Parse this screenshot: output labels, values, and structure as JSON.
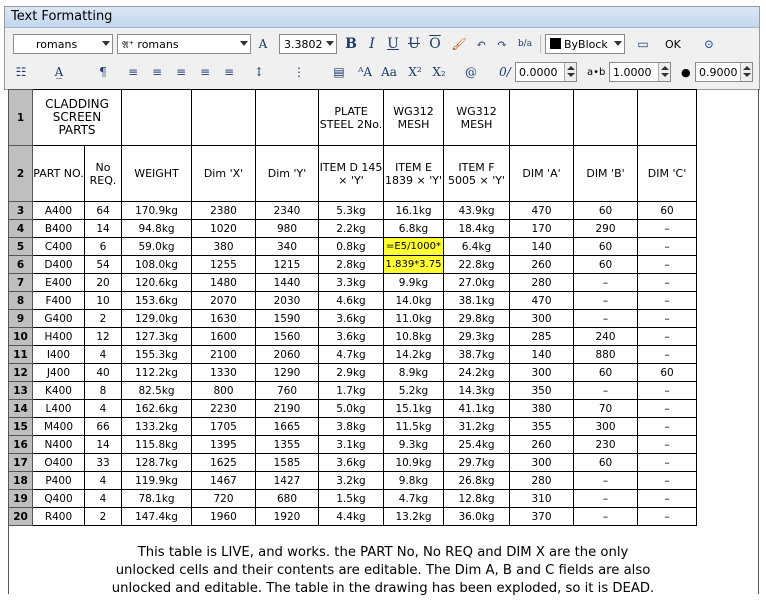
{
  "window": {
    "title": "Text Formatting"
  },
  "toolbar_row1": {
    "style_value": "romans",
    "font_value": "romans",
    "height_value": "3.3802",
    "bold": "B",
    "italic": "I",
    "underline": "U",
    "overline": "O",
    "stack": "b/a",
    "color_value": "ByBlock",
    "ok": "OK"
  },
  "toolbar_row2": {
    "oblique_value": "0.0000",
    "tracking_value": "1.0000",
    "width_value": "0.9000",
    "superscript": "X²",
    "subscript": "X₂",
    "at": "@"
  },
  "table": {
    "row1": {
      "num": "1",
      "title": "CLADDING SCREEN PARTS",
      "plate": "PLATE STEEL 2No.",
      "mesh1": "WG312 MESH",
      "mesh2": "WG312 MESH"
    },
    "row2": {
      "num": "2",
      "headers": [
        "PART NO.",
        "No REQ.",
        "WEIGHT",
        "Dim 'X'",
        "Dim 'Y'",
        "ITEM D 145 × 'Y'",
        "ITEM E 1839 × 'Y'",
        "ITEM F 5005 × 'Y'",
        "DIM 'A'",
        "DIM 'B'",
        "DIM 'C'"
      ]
    },
    "rows": [
      {
        "n": "3",
        "c": [
          "A400",
          "64",
          "170.9kg",
          "2380",
          "2340",
          "5.3kg",
          "16.1kg",
          "43.9kg",
          "470",
          "60",
          "60"
        ]
      },
      {
        "n": "4",
        "c": [
          "B400",
          "14",
          "94.8kg",
          "1020",
          "980",
          "2.2kg",
          "6.8kg",
          "18.4kg",
          "170",
          "290",
          "–"
        ]
      },
      {
        "n": "5",
        "c": [
          "C400",
          "6",
          "59.0kg",
          "380",
          "340",
          "0.8kg",
          "=E5/1000*",
          "6.4kg",
          "140",
          "60",
          "–"
        ]
      },
      {
        "n": "6",
        "c": [
          "D400",
          "54",
          "108.0kg",
          "1255",
          "1215",
          "2.8kg",
          "1.839*3.75",
          "22.8kg",
          "260",
          "60",
          "–"
        ]
      },
      {
        "n": "7",
        "c": [
          "E400",
          "20",
          "120.6kg",
          "1480",
          "1440",
          "3.3kg",
          "9.9kg",
          "27.0kg",
          "280",
          "–",
          "–"
        ]
      },
      {
        "n": "8",
        "c": [
          "F400",
          "10",
          "153.6kg",
          "2070",
          "2030",
          "4.6kg",
          "14.0kg",
          "38.1kg",
          "470",
          "–",
          "–"
        ]
      },
      {
        "n": "9",
        "c": [
          "G400",
          "2",
          "129.0kg",
          "1630",
          "1590",
          "3.6kg",
          "11.0kg",
          "29.8kg",
          "300",
          "–",
          "–"
        ]
      },
      {
        "n": "10",
        "c": [
          "H400",
          "12",
          "127.3kg",
          "1600",
          "1560",
          "3.6kg",
          "10.8kg",
          "29.3kg",
          "285",
          "240",
          "–"
        ]
      },
      {
        "n": "11",
        "c": [
          "I400",
          "4",
          "155.3kg",
          "2100",
          "2060",
          "4.7kg",
          "14.2kg",
          "38.7kg",
          "140",
          "880",
          "–"
        ]
      },
      {
        "n": "12",
        "c": [
          "J400",
          "40",
          "112.2kg",
          "1330",
          "1290",
          "2.9kg",
          "8.9kg",
          "24.2kg",
          "300",
          "60",
          "60"
        ]
      },
      {
        "n": "13",
        "c": [
          "K400",
          "8",
          "82.5kg",
          "800",
          "760",
          "1.7kg",
          "5.2kg",
          "14.3kg",
          "350",
          "–",
          "–"
        ]
      },
      {
        "n": "14",
        "c": [
          "L400",
          "4",
          "162.6kg",
          "2230",
          "2190",
          "5.0kg",
          "15.1kg",
          "41.1kg",
          "380",
          "70",
          "–"
        ]
      },
      {
        "n": "15",
        "c": [
          "M400",
          "66",
          "133.2kg",
          "1705",
          "1665",
          "3.8kg",
          "11.5kg",
          "31.2kg",
          "355",
          "300",
          "–"
        ]
      },
      {
        "n": "16",
        "c": [
          "N400",
          "14",
          "115.8kg",
          "1395",
          "1355",
          "3.1kg",
          "9.3kg",
          "25.4kg",
          "260",
          "230",
          "–"
        ]
      },
      {
        "n": "17",
        "c": [
          "O400",
          "33",
          "128.7kg",
          "1625",
          "1585",
          "3.6kg",
          "10.9kg",
          "29.7kg",
          "300",
          "60",
          "–"
        ]
      },
      {
        "n": "18",
        "c": [
          "P400",
          "4",
          "119.9kg",
          "1467",
          "1427",
          "3.2kg",
          "9.8kg",
          "26.8kg",
          "280",
          "–",
          "–"
        ]
      },
      {
        "n": "19",
        "c": [
          "Q400",
          "4",
          "78.1kg",
          "720",
          "680",
          "1.5kg",
          "4.7kg",
          "12.8kg",
          "310",
          "–",
          "–"
        ]
      },
      {
        "n": "20",
        "c": [
          "R400",
          "2",
          "147.4kg",
          "1960",
          "1920",
          "4.4kg",
          "13.2kg",
          "36.0kg",
          "370",
          "–",
          "–"
        ]
      }
    ]
  },
  "note": {
    "line1": "This table is LIVE, and works. the PART No, No REQ and DIM X are the only",
    "line2": "unlocked cells and their contents are editable. The Dim A, B and C fields are also",
    "line3": "unlocked and editable.  The table in the drawing has been exploded, so it is DEAD."
  },
  "colors": {
    "highlight": "#ffff33",
    "row_number_bg": "#bfbfbf",
    "titlebar": "#c3d6ee"
  }
}
